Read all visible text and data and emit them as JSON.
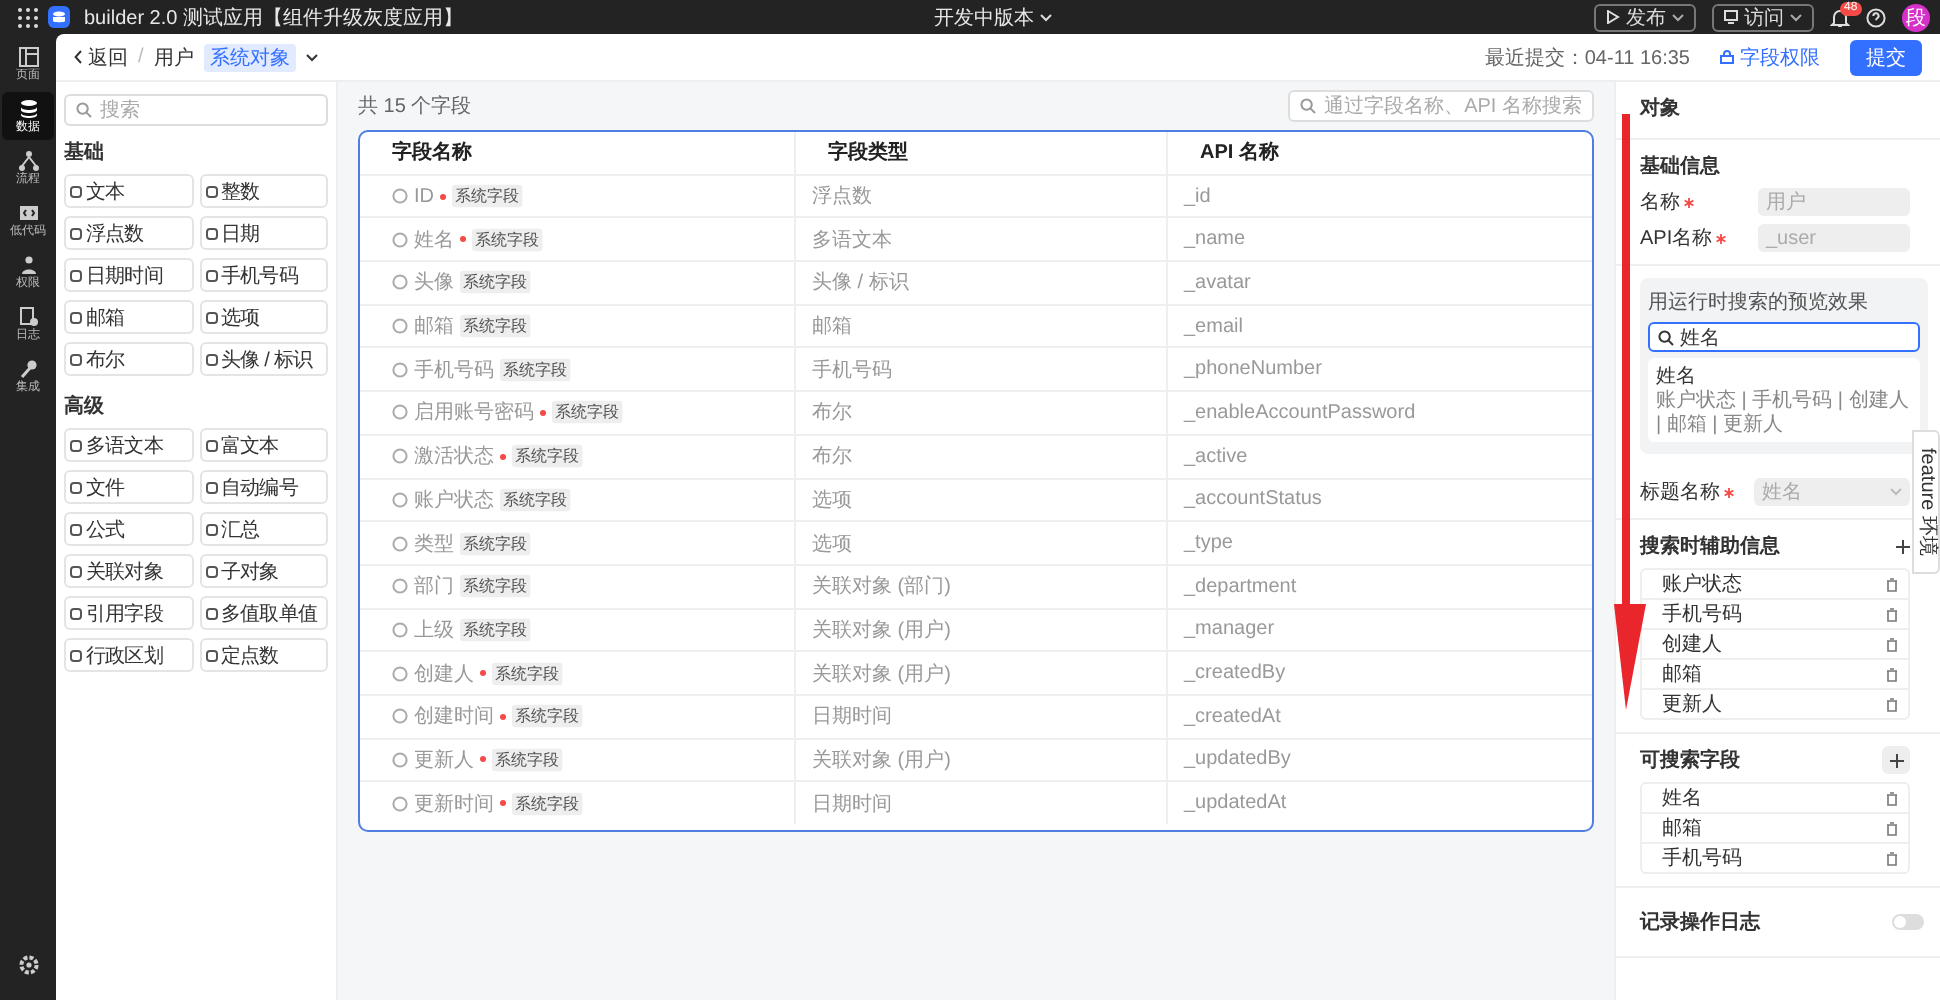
{
  "topbar": {
    "title": "builder 2.0 测试应用【组件升级灰度应用】",
    "version": "开发中版本",
    "publish": "发布",
    "visit": "访问",
    "notifications": "48",
    "avatar": "段"
  },
  "rail": [
    {
      "label": "页面",
      "selected": false
    },
    {
      "label": "数据",
      "selected": true
    },
    {
      "label": "流程",
      "selected": false
    },
    {
      "label": "低代码",
      "selected": false
    },
    {
      "label": "权限",
      "selected": false
    },
    {
      "label": "日志",
      "selected": false
    },
    {
      "label": "集成",
      "selected": false
    }
  ],
  "header": {
    "back": "返回",
    "separator": "/",
    "object": "用户",
    "object_tag": "系统对象",
    "last_commit": "最近提交：04-11 16:35",
    "permissions": "字段权限",
    "submit": "提交"
  },
  "palette": {
    "search_placeholder": "搜索",
    "groups": [
      {
        "title": "基础",
        "items": [
          "文本",
          "整数",
          "浮点数",
          "日期",
          "日期时间",
          "手机号码",
          "邮箱",
          "选项",
          "布尔",
          "头像 / 标识"
        ]
      },
      {
        "title": "高级",
        "items": [
          "多语文本",
          "富文本",
          "文件",
          "自动编号",
          "公式",
          "汇总",
          "关联对象",
          "子对象",
          "引用字段",
          "多值取单值",
          "行政区划",
          "定点数"
        ]
      }
    ]
  },
  "table": {
    "count": "共 15 个字段",
    "search_placeholder": "通过字段名称、API 名称搜索",
    "columns": [
      "字段名称",
      "字段类型",
      "API 名称"
    ],
    "rows": [
      {
        "name": "ID",
        "required": true,
        "tag": "系统字段",
        "type": "浮点数",
        "api": "_id"
      },
      {
        "name": "姓名",
        "required": true,
        "tag": "系统字段",
        "type": "多语文本",
        "api": "_name"
      },
      {
        "name": "头像",
        "required": false,
        "tag": "系统字段",
        "type": "头像 / 标识",
        "api": "_avatar"
      },
      {
        "name": "邮箱",
        "required": false,
        "tag": "系统字段",
        "type": "邮箱",
        "api": "_email"
      },
      {
        "name": "手机号码",
        "required": false,
        "tag": "系统字段",
        "type": "手机号码",
        "api": "_phoneNumber"
      },
      {
        "name": "启用账号密码",
        "required": true,
        "tag": "系统字段",
        "type": "布尔",
        "api": "_enableAccountPassword"
      },
      {
        "name": "激活状态",
        "required": true,
        "tag": "系统字段",
        "type": "布尔",
        "api": "_active"
      },
      {
        "name": "账户状态",
        "required": false,
        "tag": "系统字段",
        "type": "选项",
        "api": "_accountStatus"
      },
      {
        "name": "类型",
        "required": false,
        "tag": "系统字段",
        "type": "选项",
        "api": "_type"
      },
      {
        "name": "部门",
        "required": false,
        "tag": "系统字段",
        "type": "关联对象 (部门)",
        "api": "_department"
      },
      {
        "name": "上级",
        "required": false,
        "tag": "系统字段",
        "type": "关联对象 (用户)",
        "api": "_manager"
      },
      {
        "name": "创建人",
        "required": true,
        "tag": "系统字段",
        "type": "关联对象 (用户)",
        "api": "_createdBy"
      },
      {
        "name": "创建时间",
        "required": true,
        "tag": "系统字段",
        "type": "日期时间",
        "api": "_createdAt"
      },
      {
        "name": "更新人",
        "required": true,
        "tag": "系统字段",
        "type": "关联对象 (用户)",
        "api": "_updatedBy"
      },
      {
        "name": "更新时间",
        "required": true,
        "tag": "系统字段",
        "type": "日期时间",
        "api": "_updatedAt"
      }
    ]
  },
  "panel": {
    "title": "对象",
    "section": "基础信息",
    "fields": [
      {
        "kind": "input",
        "label": "名称",
        "required": true,
        "value": "用户"
      },
      {
        "kind": "input",
        "label": "API名称",
        "required": true,
        "value": "_user"
      }
    ],
    "preview": {
      "caption": "用运行时搜索的预览效果",
      "query": "姓名",
      "result_title": "姓名",
      "result_sub": "账户状态 | 手机号码 | 创建人 | 邮箱 | 更新人"
    },
    "title_field": {
      "kind": "select",
      "label": "标题名称",
      "required": true,
      "value": "姓名"
    },
    "aux_title": "搜索时辅助信息",
    "aux_items": [
      "账户状态",
      "手机号码",
      "创建人",
      "邮箱",
      "更新人"
    ],
    "searchable_title": "可搜索字段",
    "searchable_items": [
      "姓名",
      "邮箱",
      "手机号码"
    ],
    "log_label": "记录操作日志",
    "log_on": false,
    "feature_tab": "feature 环境"
  }
}
